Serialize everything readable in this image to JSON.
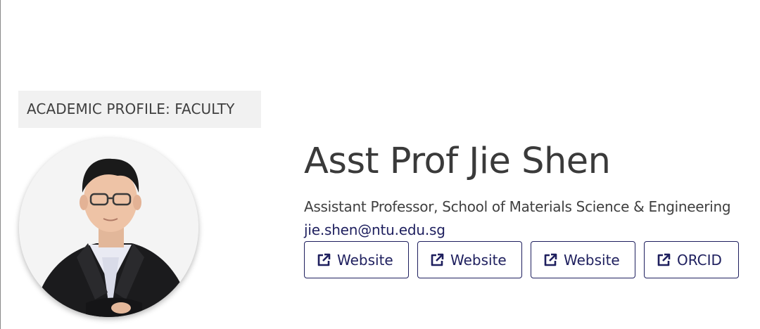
{
  "profile": {
    "category_tag": "ACADEMIC PROFILE: FACULTY",
    "name": "Asst Prof Jie Shen",
    "role": "Assistant Professor, School of Materials Science & Engineering",
    "email": "jie.shen@ntu.edu.sg"
  },
  "links": [
    {
      "label": "Website",
      "icon": "external-link-icon"
    },
    {
      "label": "Website",
      "icon": "external-link-icon"
    },
    {
      "label": "Website",
      "icon": "external-link-icon"
    },
    {
      "label": "ORCID",
      "icon": "external-link-icon"
    }
  ],
  "colors": {
    "accent": "#1e1f5e",
    "tag_background": "#f1f1f1",
    "text": "#3a3a3a"
  }
}
